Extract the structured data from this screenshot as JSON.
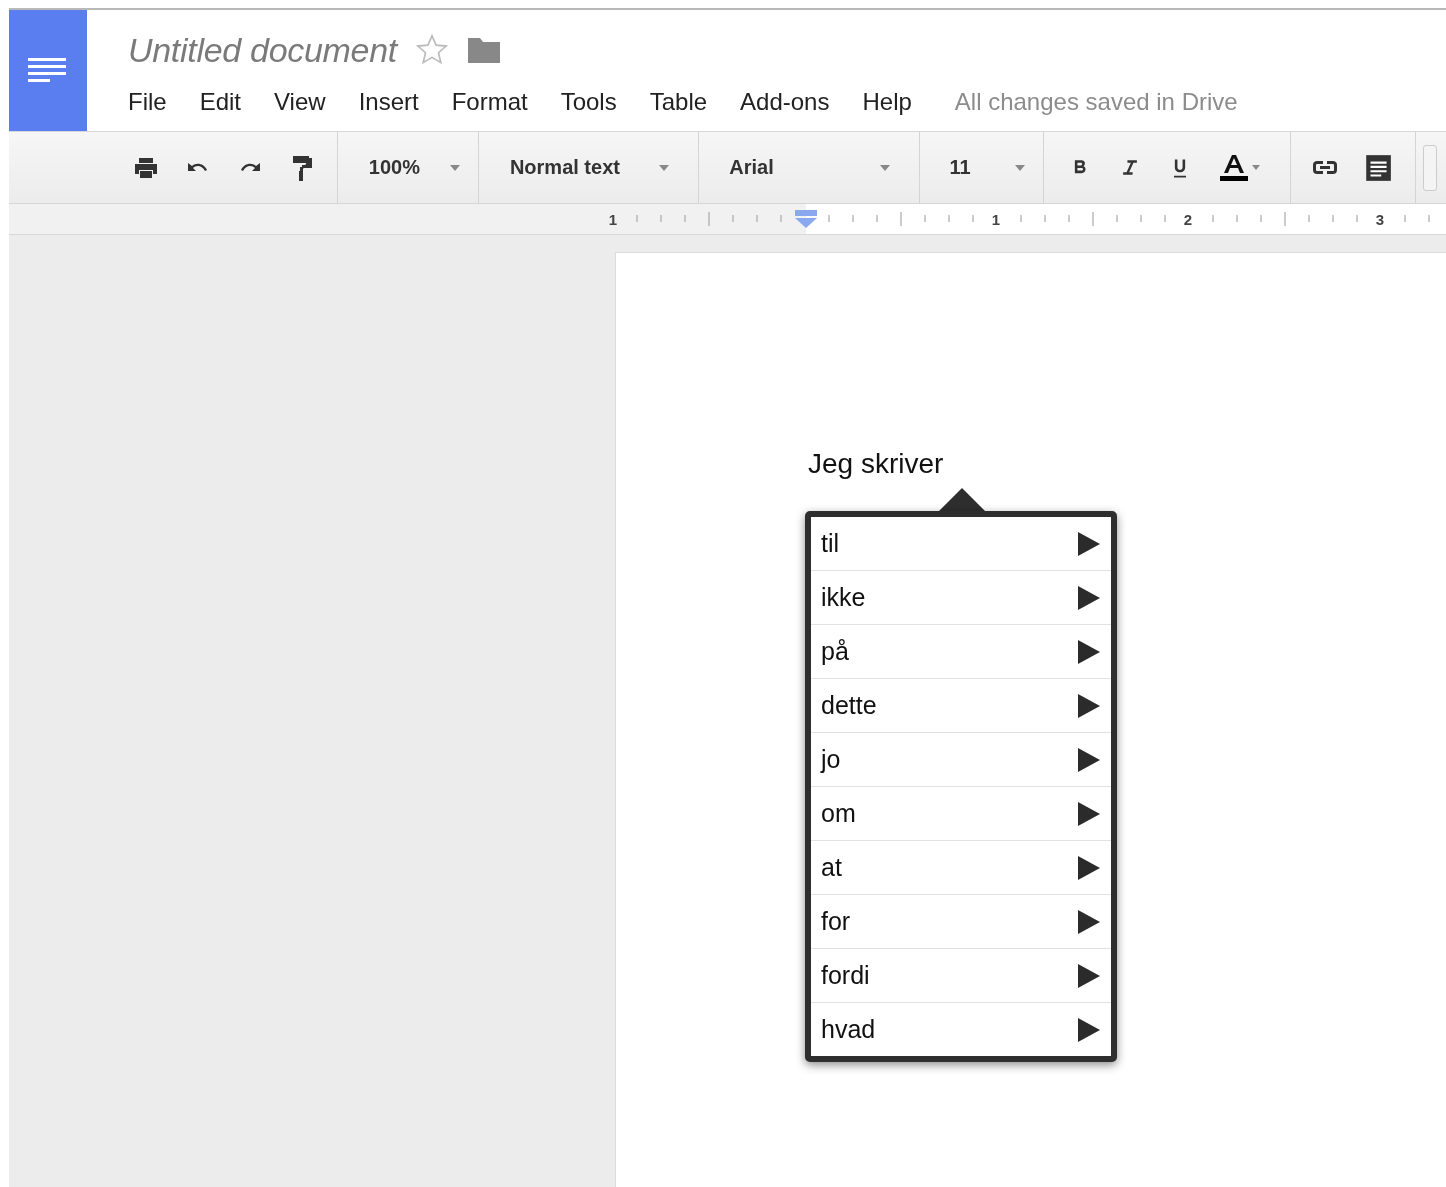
{
  "document": {
    "title": "Untitled document",
    "starred": false
  },
  "menu": [
    "File",
    "Edit",
    "View",
    "Insert",
    "Format",
    "Tools",
    "Table",
    "Add-ons",
    "Help"
  ],
  "save_status": "All changes saved in Drive",
  "toolbar": {
    "zoom": "100%",
    "style": "Normal text",
    "font": "Arial",
    "size": "11"
  },
  "ruler": [
    "1",
    "1",
    "2",
    "3"
  ],
  "body_text": "Jeg skriver",
  "suggestions": [
    {
      "word": "til"
    },
    {
      "word": "ikke"
    },
    {
      "word": "på"
    },
    {
      "word": "dette"
    },
    {
      "word": "jo"
    },
    {
      "word": "om"
    },
    {
      "word": "at"
    },
    {
      "word": "for"
    },
    {
      "word": "fordi"
    },
    {
      "word": "hvad"
    }
  ]
}
